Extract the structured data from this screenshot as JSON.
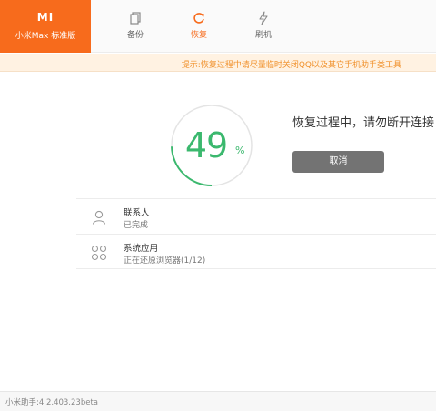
{
  "brand": {
    "logo": "MI",
    "title": "小米Max 标准版"
  },
  "tabs": [
    {
      "label": "备份",
      "icon": "backup-icon",
      "active": false
    },
    {
      "label": "恢复",
      "icon": "restore-icon",
      "active": true
    },
    {
      "label": "刷机",
      "icon": "flash-icon",
      "active": false
    }
  ],
  "notice": "提示:恢复过程中请尽量临时关闭QQ以及其它手机助手类工具",
  "progress": {
    "value": 49,
    "percent_sign": "%"
  },
  "status": {
    "text": "恢复过程中，请勿断开连接",
    "cancel_label": "取消"
  },
  "items": [
    {
      "icon": "contact-icon",
      "title": "联系人",
      "subtitle": "已完成"
    },
    {
      "icon": "apps-icon",
      "title": "系统应用",
      "subtitle": "正在还原浏览器(1/12)"
    }
  ],
  "footer": {
    "version": "小米助手:4.2.403.23beta"
  },
  "colors": {
    "brand": "#f76b1c",
    "progress": "#3bb86e",
    "notice_text": "#f0902a"
  }
}
